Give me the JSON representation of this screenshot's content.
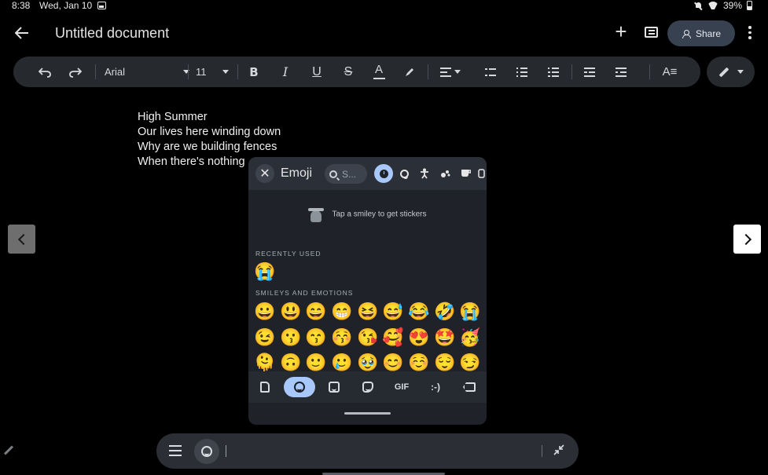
{
  "status_bar": {
    "time": "8:38",
    "date": "Wed, Jan 10",
    "battery": "39%"
  },
  "app_bar": {
    "title": "Untitled document",
    "share_label": "Share"
  },
  "toolbar": {
    "font": "Arial",
    "font_size": "11"
  },
  "document": {
    "lines": [
      "High Summer",
      "Our lives here winding down",
      "Why are we building fences",
      "When there's nothing"
    ]
  },
  "emoji_panel": {
    "title": "Emoji",
    "search_placeholder": "S...",
    "sticker_hint": "Tap a smiley to get stickers",
    "recently_used_label": "RECENTLY USED",
    "smileys_label": "SMILEYS AND EMOTIONS",
    "recent": [
      "😭"
    ],
    "smileys": [
      [
        "😀",
        "😃",
        "😄",
        "😁",
        "😆",
        "😅",
        "😂",
        "🤣",
        "😭"
      ],
      [
        "😉",
        "😗",
        "😙",
        "😚",
        "😘",
        "🥰",
        "😍",
        "🤩",
        "🥳"
      ],
      [
        "🫠",
        "🙃",
        "🙂",
        "🥲",
        "🥹",
        "😊",
        "☺️",
        "😌",
        "😏"
      ]
    ],
    "tab_gif_label": "GIF",
    "tab_emoticon_label": ":-)"
  },
  "colors": {
    "background": "#000000",
    "toolbar": "#262a2f",
    "accent": "#a8c7fa",
    "share_button": "#38414f"
  }
}
